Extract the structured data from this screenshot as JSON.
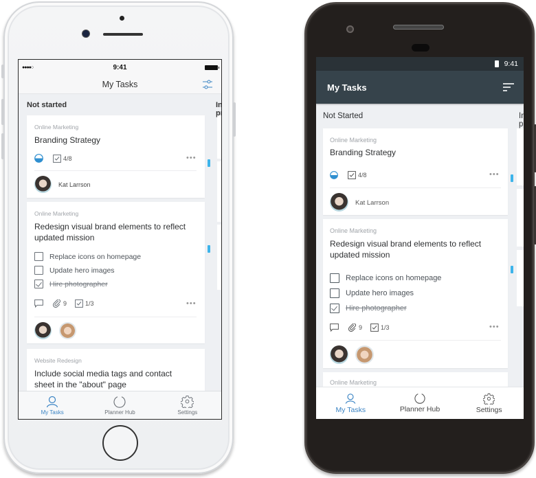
{
  "ios": {
    "status": {
      "signal": "●●●●○",
      "time": "9:41"
    },
    "nav": {
      "title": "My Tasks",
      "filter_icon": "filter-sliders-icon"
    },
    "columns": [
      {
        "label": "Not started"
      },
      {
        "label": "In progress"
      }
    ],
    "cards": [
      {
        "bucket": "Online Marketing",
        "title": "Branding Strategy",
        "progress_icon": "half-circle-progress-icon",
        "checklist_count": "4/8",
        "assignees": [
          {
            "name": "Kat Larrson"
          }
        ]
      },
      {
        "bucket": "Online Marketing",
        "title_lines": [
          "Redesign visual brand elements to reflect",
          "updated mission"
        ],
        "checklist": [
          {
            "label": "Replace icons on homepage",
            "checked": false
          },
          {
            "label": "Update hero images",
            "checked": false
          },
          {
            "label": "Hire photographer",
            "checked": true
          }
        ],
        "attachments": "9",
        "checklist_count": "1/3"
      },
      {
        "bucket": "Website Redesign",
        "title_lines": [
          "Include social media tags and contact",
          "sheet in the \"about\" page"
        ]
      }
    ],
    "tabs": [
      {
        "label": "My Tasks",
        "icon": "person-icon",
        "active": true
      },
      {
        "label": "Planner Hub",
        "icon": "circle-icon",
        "active": false
      },
      {
        "label": "Settings",
        "icon": "gear-icon",
        "active": false
      }
    ]
  },
  "android": {
    "status": {
      "time": "9:41"
    },
    "toolbar": {
      "title": "My Tasks",
      "sort_icon": "sort-icon"
    },
    "columns": [
      {
        "label": "Not Started"
      },
      {
        "label": "In progress"
      }
    ],
    "cards": [
      {
        "bucket": "Online Marketing",
        "title": "Branding Strategy",
        "checklist_count": "4/8",
        "assignees": [
          {
            "name": "Kat Larrson"
          }
        ]
      },
      {
        "bucket": "Online Marketing",
        "title_lines": [
          "Redesign visual brand elements to reflect",
          "updated mission"
        ],
        "checklist": [
          {
            "label": "Replace icons on homepage",
            "checked": false
          },
          {
            "label": "Update hero images",
            "checked": false
          },
          {
            "label": "Hire photographer",
            "checked": true
          }
        ],
        "attachments": "9",
        "checklist_count": "1/3"
      },
      {
        "bucket": "Online Marketing"
      }
    ],
    "tabs": [
      {
        "label": "My Tasks",
        "active": true
      },
      {
        "label": "Planner Hub",
        "active": false
      },
      {
        "label": "Settings",
        "active": false
      }
    ]
  },
  "colors": {
    "accent": "#3b84c4",
    "progress_blue": "#2f8fd0",
    "card_marker": "#3db4ea",
    "android_toolbar": "#36434b",
    "android_statusbar": "#2a3237"
  }
}
